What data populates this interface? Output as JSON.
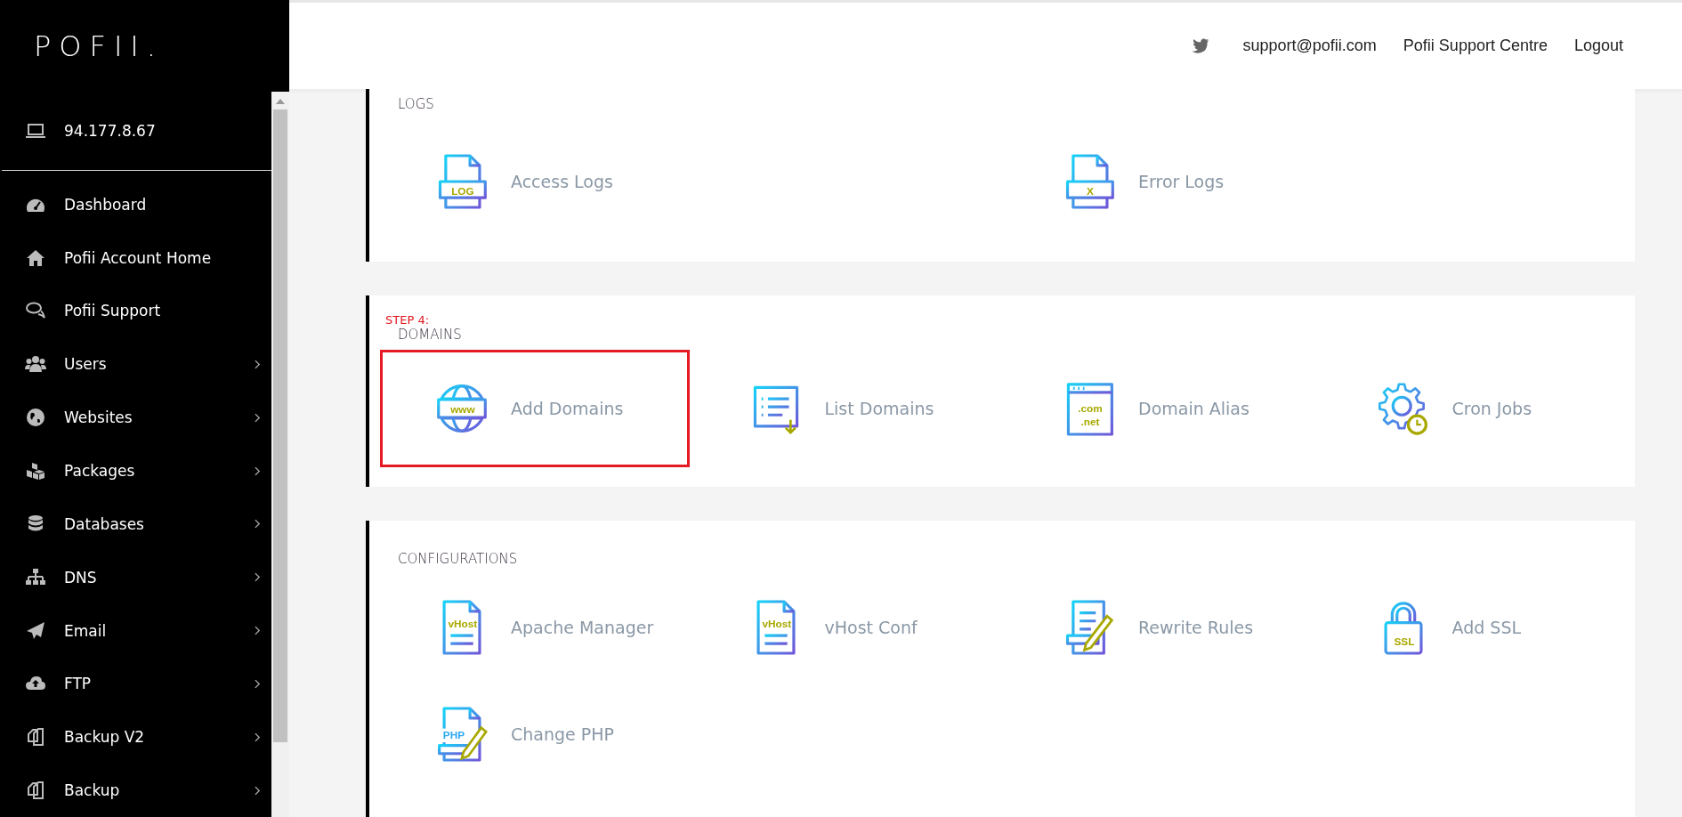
{
  "logo": "POFII.",
  "header": {
    "links": [
      "support@pofii.com",
      "Pofii Support Centre",
      "Logout"
    ]
  },
  "sidebar": {
    "ip": "94.177.8.67",
    "items": [
      {
        "label": "Dashboard",
        "kind": "gauge",
        "expandable": false
      },
      {
        "label": "Pofii Account Home",
        "kind": "home",
        "expandable": false
      },
      {
        "label": "Pofii Support",
        "kind": "chat",
        "expandable": false
      },
      {
        "label": "Users",
        "kind": "users",
        "expandable": true
      },
      {
        "label": "Websites",
        "kind": "globe",
        "expandable": true
      },
      {
        "label": "Packages",
        "kind": "cubes",
        "expandable": true
      },
      {
        "label": "Databases",
        "kind": "database",
        "expandable": true
      },
      {
        "label": "DNS",
        "kind": "sitemap",
        "expandable": true
      },
      {
        "label": "Email",
        "kind": "plane",
        "expandable": true
      },
      {
        "label": "FTP",
        "kind": "cloud",
        "expandable": true
      },
      {
        "label": "Backup V2",
        "kind": "copy",
        "expandable": true
      },
      {
        "label": "Backup",
        "kind": "copy",
        "expandable": true
      }
    ]
  },
  "sections": [
    {
      "title": "LOGS",
      "tiles": [
        {
          "label": "Access Logs",
          "kind": "file",
          "badge": "LOG",
          "highlighted": false
        },
        {
          "label": "Error Logs",
          "kind": "file",
          "badge": "X",
          "highlighted": false
        }
      ]
    },
    {
      "step": "STEP 4:",
      "title": "DOMAINS",
      "tiles": [
        {
          "label": "Add Domains",
          "kind": "globe",
          "badge": "www",
          "highlighted": true
        },
        {
          "label": "List Domains",
          "kind": "list",
          "highlighted": false
        },
        {
          "label": "Domain Alias",
          "kind": "browser",
          "badge": ".com",
          "badge2": ".net",
          "highlighted": false
        },
        {
          "label": "Cron Jobs",
          "kind": "gear",
          "highlighted": false
        }
      ]
    },
    {
      "title": "CONFIGURATIONS",
      "tiles": [
        {
          "label": "Apache Manager",
          "kind": "vhost",
          "badge": "vHost",
          "highlighted": false
        },
        {
          "label": "vHost Conf",
          "kind": "vhost",
          "badge": "vHost",
          "highlighted": false
        },
        {
          "label": "Rewrite Rules",
          "kind": "edit",
          "highlighted": false
        },
        {
          "label": "Add SSL",
          "kind": "lock",
          "badge": "SSL",
          "highlighted": false
        },
        {
          "label": "Change PHP",
          "kind": "php",
          "badge": "PHP",
          "highlighted": false
        }
      ]
    }
  ]
}
